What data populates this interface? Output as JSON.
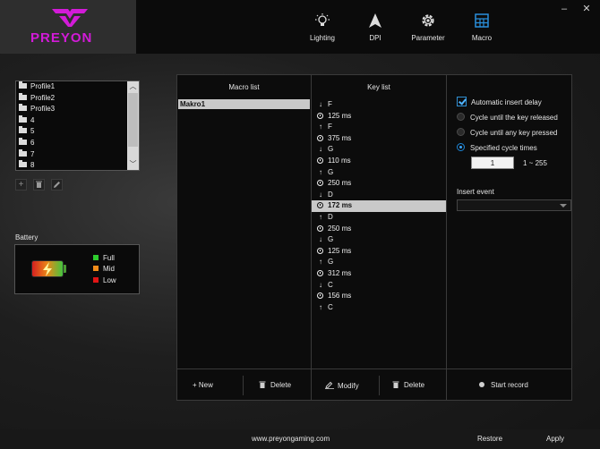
{
  "header": {
    "brand": "PREYON",
    "brand_color": "#d21bd8",
    "window_controls": [
      {
        "icon": "minimize-icon",
        "glyph": "–"
      },
      {
        "icon": "close-icon",
        "glyph": "✕"
      }
    ],
    "tabs": [
      {
        "label": "Lighting",
        "icon": "bulb-icon"
      },
      {
        "label": "DPI",
        "icon": "cursor-arrow-icon"
      },
      {
        "label": "Parameter",
        "icon": "gear-icon"
      },
      {
        "label": "Macro",
        "icon": "grid-icon",
        "active": true
      }
    ],
    "active_tab_color": "#2a8fdc"
  },
  "profiles": {
    "items": [
      "Profile1",
      "Profile2",
      "Profile3",
      "4",
      "5",
      "6",
      "7",
      "8"
    ],
    "tools": [
      {
        "icon": "add-icon",
        "glyph": "+"
      },
      {
        "icon": "trash-icon",
        "glyph": "🗑"
      },
      {
        "icon": "pencil-icon",
        "glyph": "✎"
      }
    ]
  },
  "battery": {
    "title": "Battery",
    "legend": [
      {
        "label": "Full",
        "color": "#2ecc2e"
      },
      {
        "label": "Mid",
        "color": "#f08c1a"
      },
      {
        "label": "Low",
        "color": "#e01515"
      }
    ]
  },
  "macro": {
    "macro_list_title": "Macro list",
    "key_list_title": "Key list",
    "selected_macro": "Makro1",
    "keys": [
      {
        "type": "down",
        "text": "F"
      },
      {
        "type": "delay",
        "text": "125 ms"
      },
      {
        "type": "up",
        "text": "F"
      },
      {
        "type": "delay",
        "text": "375 ms"
      },
      {
        "type": "down",
        "text": "G"
      },
      {
        "type": "delay",
        "text": "110 ms"
      },
      {
        "type": "up",
        "text": "G"
      },
      {
        "type": "delay",
        "text": "250 ms"
      },
      {
        "type": "down",
        "text": "D"
      },
      {
        "type": "delay",
        "text": "172 ms",
        "selected": true
      },
      {
        "type": "up",
        "text": "D"
      },
      {
        "type": "delay",
        "text": "250 ms"
      },
      {
        "type": "down",
        "text": "G"
      },
      {
        "type": "delay",
        "text": "125 ms"
      },
      {
        "type": "up",
        "text": "G"
      },
      {
        "type": "delay",
        "text": "312 ms"
      },
      {
        "type": "down",
        "text": "C"
      },
      {
        "type": "delay",
        "text": "156 ms"
      },
      {
        "type": "up",
        "text": "C"
      }
    ],
    "buttons": {
      "new": "+ New",
      "delete_macro": "Delete",
      "modify": "Modify",
      "delete_key": "Delete",
      "start_record": "Start record"
    },
    "options": {
      "auto_insert_delay": "Automatic insert delay",
      "auto_insert_checked": true,
      "cycle_released": "Cycle until the key released",
      "cycle_any_key": "Cycle until any key pressed",
      "specified_times": "Specified cycle times",
      "selected_mode": "specified",
      "cycle_times_value": "1",
      "cycle_range": "1 ~ 255",
      "insert_event_label": "Insert event",
      "insert_event_value": ""
    }
  },
  "footer": {
    "website": "www.preyongaming.com",
    "restore": "Restore",
    "apply": "Apply"
  }
}
